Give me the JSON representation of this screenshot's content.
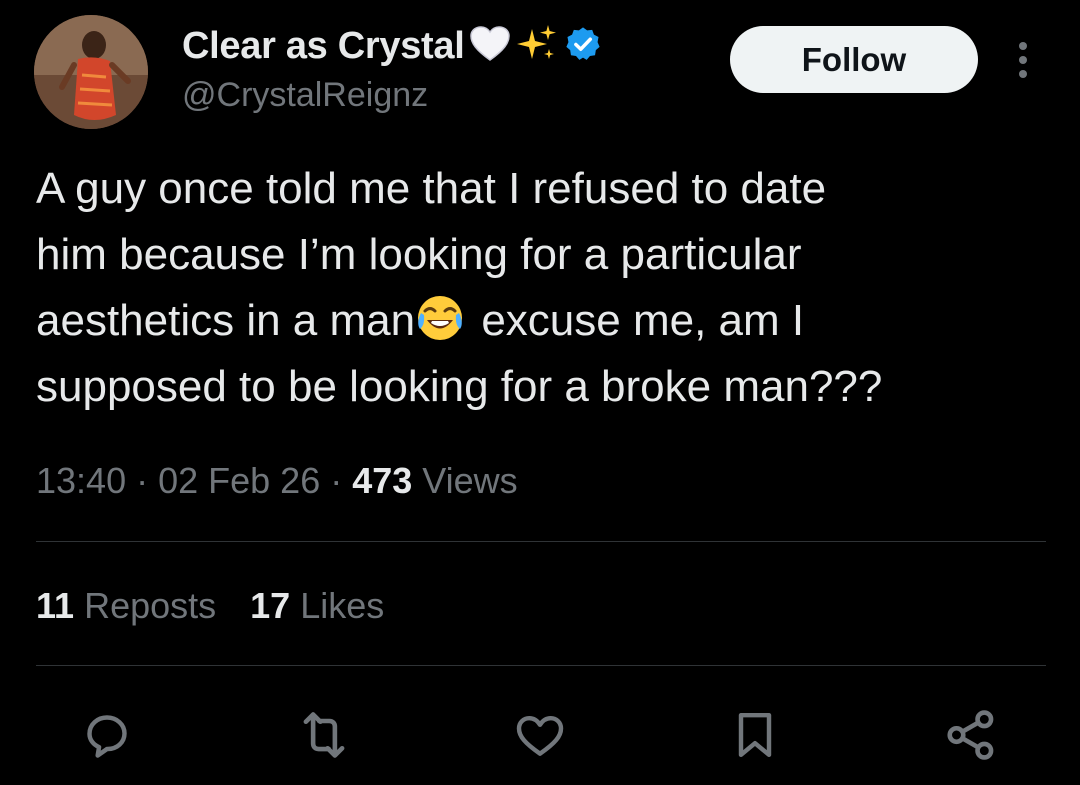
{
  "author": {
    "display_name": "Clear as Crystal",
    "handle": "@CrystalReignz",
    "name_icons": [
      "white-heart-icon",
      "sparkles-icon",
      "verified-badge-icon"
    ]
  },
  "follow_button": {
    "label": "Follow"
  },
  "tweet": {
    "lines": [
      "A guy once told me that I refused to date",
      "him because I’m looking for a particular",
      "aesthetics in a man",
      " excuse me, am I",
      "supposed to be looking for a broke man???"
    ],
    "inline_emoji": "face-with-tears-of-joy-icon"
  },
  "meta": {
    "time": "13:40",
    "date": "02 Feb 26",
    "separator": " · ",
    "views_count": "473",
    "views_label": " Views"
  },
  "stats": {
    "reposts_count": "11",
    "reposts_label": " Reposts",
    "likes_count": "17",
    "likes_label": " Likes"
  },
  "actions": [
    "reply-icon",
    "repost-icon",
    "like-icon",
    "bookmark-icon",
    "share-icon"
  ],
  "colors": {
    "background": "#000000",
    "primary_text": "#e7e9ea",
    "secondary_text": "#71767b",
    "divider": "#2f3336",
    "follow_bg": "#eff3f4",
    "verified_blue": "#1d9bf0"
  }
}
